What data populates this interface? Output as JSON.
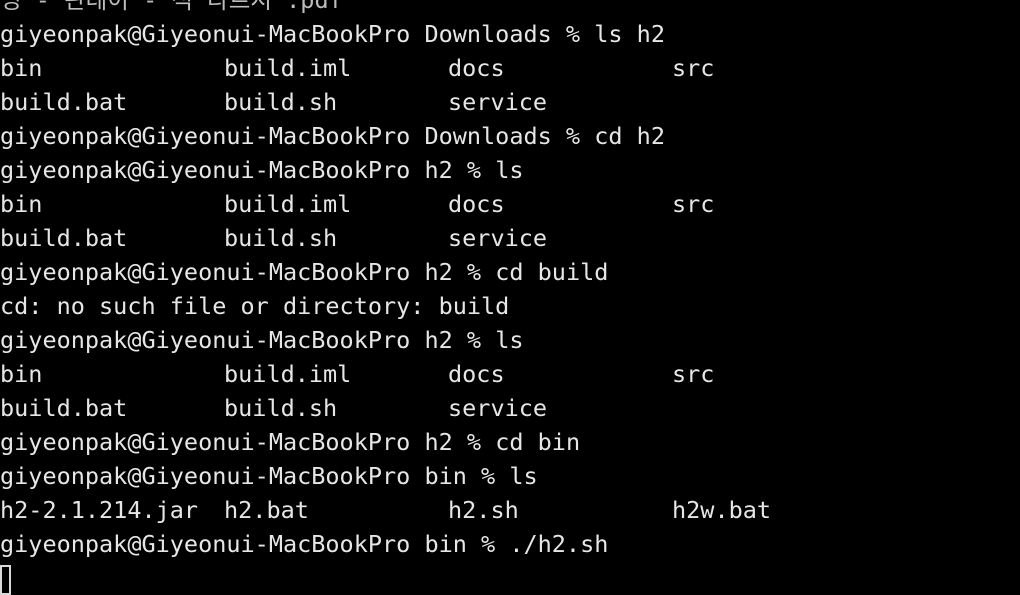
{
  "terminal": {
    "top_partial": "명 - 판데이 - 적 다르시 .pdf",
    "prompt_downloads": "giyeonpak@Giyeonui-MacBookPro Downloads %",
    "prompt_h2": "giyeonpak@Giyeonui-MacBookPro h2 %",
    "prompt_bin": "giyeonpak@Giyeonui-MacBookPro bin %",
    "cmd1": "ls h2",
    "cmd2": "cd h2",
    "cmd3": "ls",
    "cmd4": "cd build",
    "cmd5": "ls",
    "cmd6": "cd bin",
    "cmd7": "ls",
    "cmd8": "./h2.sh",
    "error": "cd: no such file or directory: build",
    "h2_listing": [
      "bin",
      "build.iml",
      "docs",
      "src",
      "build.bat",
      "build.sh",
      "service"
    ],
    "bin_listing": [
      "h2-2.1.214.jar",
      "h2.bat",
      "h2.sh",
      "h2w.bat"
    ]
  }
}
